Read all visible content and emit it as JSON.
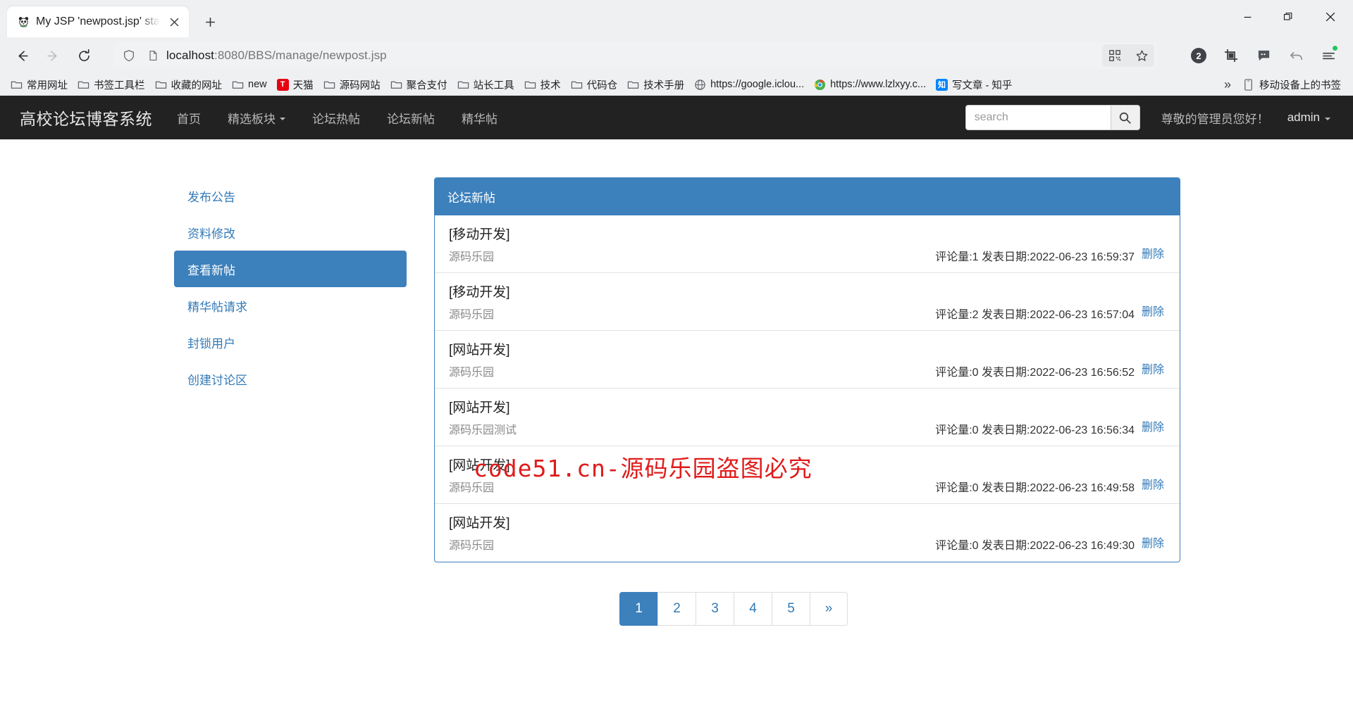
{
  "browser": {
    "tab": {
      "title": "My JSP 'newpost.jsp' starting",
      "favicon": "panda-icon",
      "close_label": "✕"
    },
    "new_tab_label": "+",
    "window_controls": {
      "minimize": "—",
      "maximize": "❐",
      "close": "✕"
    },
    "nav": {
      "back": "←",
      "forward": "→",
      "reload": "⟳"
    },
    "omnibox": {
      "shield_icon": "shield-icon",
      "page_icon": "document-icon",
      "url_host": "localhost",
      "url_rest": ":8080/BBS/manage/newpost.jsp",
      "qr_icon": "qr-code-icon",
      "star_icon": "star-icon"
    },
    "toolbar_icons": [
      {
        "name": "extension-count-badge",
        "label": "2"
      },
      {
        "name": "screenshot-crop-icon",
        "label": ""
      },
      {
        "name": "chat-bubble-icon",
        "label": ""
      },
      {
        "name": "undo-arrow-icon",
        "label": ""
      },
      {
        "name": "browser-menu-icon",
        "label": ""
      }
    ],
    "bookmarks": [
      {
        "label": "常用网址",
        "icon": "folder"
      },
      {
        "label": "书签工具栏",
        "icon": "folder"
      },
      {
        "label": "收藏的网址",
        "icon": "folder"
      },
      {
        "label": "new",
        "icon": "folder"
      },
      {
        "label": "天猫",
        "icon": "tmall",
        "icon_text": "T",
        "icon_color": "#e60012"
      },
      {
        "label": "源码网站",
        "icon": "folder"
      },
      {
        "label": "聚合支付",
        "icon": "folder"
      },
      {
        "label": "站长工具",
        "icon": "folder"
      },
      {
        "label": "技术",
        "icon": "folder"
      },
      {
        "label": "代码仓",
        "icon": "folder"
      },
      {
        "label": "技术手册",
        "icon": "folder"
      },
      {
        "label": "https://google.iclou...",
        "icon": "globe"
      },
      {
        "label": "https://www.lzlxyy.c...",
        "icon": "chrome"
      },
      {
        "label": "写文章 - 知乎",
        "icon": "zhihu",
        "icon_text": "知",
        "icon_color": "#0084ff"
      }
    ],
    "bookmarks_overflow": "»",
    "mobile_bookmarks": {
      "label": "移动设备上的书签",
      "icon": "phone-icon"
    }
  },
  "site": {
    "brand": "高校论坛博客系统",
    "nav_links": [
      {
        "label": "首页",
        "caret": false
      },
      {
        "label": "精选板块",
        "caret": true
      },
      {
        "label": "论坛热帖",
        "caret": false
      },
      {
        "label": "论坛新帖",
        "caret": false
      },
      {
        "label": "精华帖",
        "caret": false
      }
    ],
    "search": {
      "placeholder": "search",
      "value": "",
      "button_icon": "search-icon"
    },
    "greeting": "尊敬的管理员您好！",
    "user": "admin"
  },
  "sidebar": {
    "items": [
      {
        "label": "发布公告",
        "active": false
      },
      {
        "label": "资料修改",
        "active": false
      },
      {
        "label": "查看新帖",
        "active": true
      },
      {
        "label": "精华帖请求",
        "active": false
      },
      {
        "label": "封锁用户",
        "active": false
      },
      {
        "label": "创建讨论区",
        "active": false
      }
    ]
  },
  "panel": {
    "title": "论坛新帖",
    "delete_label": "删除",
    "posts": [
      {
        "title": "[移动开发]",
        "author": "源码乐园",
        "stats": "评论量:1 发表日期:2022-06-23 16:59:37",
        "delete": "删除"
      },
      {
        "title": "[移动开发]",
        "author": "源码乐园",
        "stats": "评论量:2 发表日期:2022-06-23 16:57:04",
        "delete": "删除"
      },
      {
        "title": "[网站开发]",
        "author": "源码乐园",
        "stats": "评论量:0 发表日期:2022-06-23 16:56:52",
        "delete": "删除"
      },
      {
        "title": "[网站开发]",
        "author": "源码乐园测试",
        "stats": "评论量:0 发表日期:2022-06-23 16:56:34",
        "delete": "删除"
      },
      {
        "title": "[网站开发]",
        "author": "源码乐园",
        "stats": "评论量:0 发表日期:2022-06-23 16:49:58",
        "delete": "删除"
      },
      {
        "title": "[网站开发]",
        "author": "源码乐园",
        "stats": "评论量:0 发表日期:2022-06-23 16:49:30",
        "delete": "删除"
      }
    ]
  },
  "pagination": {
    "pages": [
      {
        "label": "1",
        "active": true
      },
      {
        "label": "2",
        "active": false
      },
      {
        "label": "3",
        "active": false
      },
      {
        "label": "4",
        "active": false
      },
      {
        "label": "5",
        "active": false
      },
      {
        "label": "»",
        "active": false
      }
    ]
  },
  "watermark": {
    "text": "code51.cn-源码乐园盗图必究",
    "color": "#e01b1b"
  },
  "colors": {
    "primary": "#3c80bc",
    "link": "#337ab7",
    "navbar_bg": "#222222",
    "accent_green": "#22c55e"
  }
}
